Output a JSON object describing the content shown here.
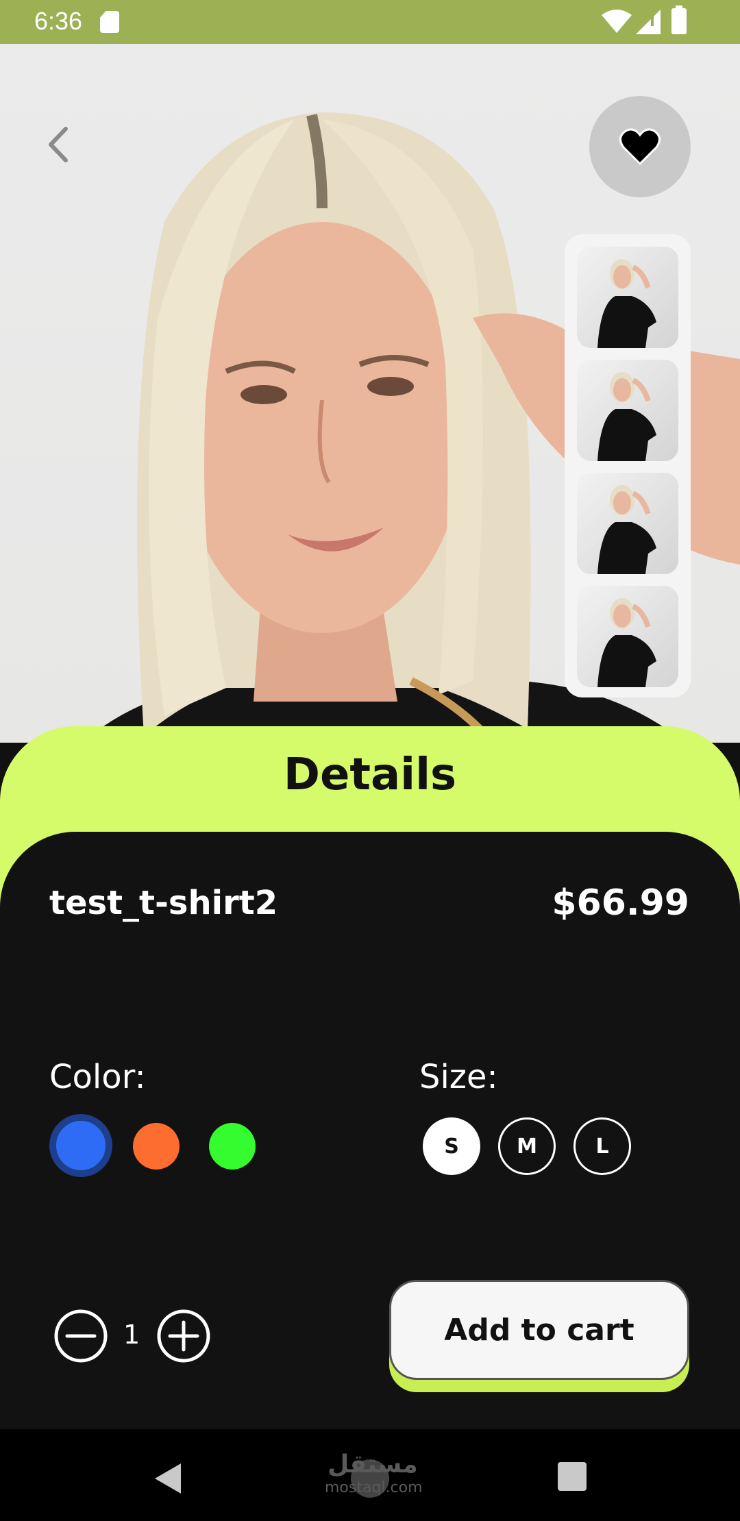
{
  "status_bar": {
    "time": "6:36"
  },
  "header": {
    "back_icon": "chevron-left-icon",
    "favorite_icon": "heart-icon"
  },
  "gallery": {
    "thumbnail_count": 4
  },
  "details": {
    "title": "Details",
    "product_name": "test_t-shirt2",
    "price": "$66.99",
    "color_label": "Color:",
    "colors": [
      "#2f6cf5",
      "#fd6d30",
      "#34fc2e"
    ],
    "selected_color": "#2f6cf5",
    "size_label": "Size:",
    "sizes": [
      "S",
      "M",
      "L"
    ],
    "selected_size": "S",
    "quantity": "1",
    "add_to_cart_label": "Add to cart"
  },
  "theme": {
    "accent": "#d5fb6a",
    "status_bar": "#9db154",
    "card": "#121212"
  },
  "watermark": {
    "line1": "مستقل",
    "line2": "mostaql.com"
  }
}
